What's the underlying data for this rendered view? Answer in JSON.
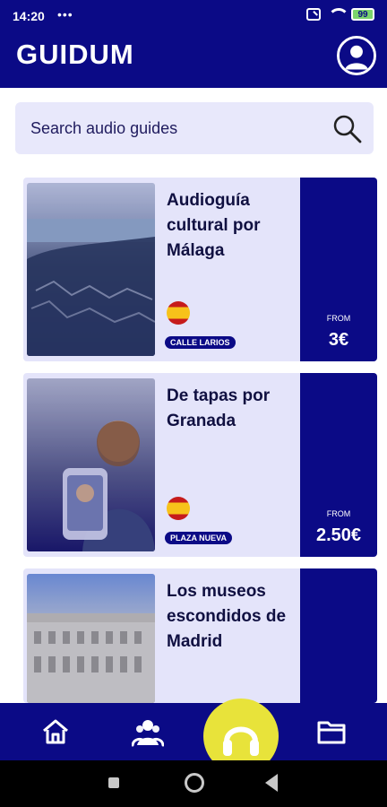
{
  "status": {
    "time": "14:20",
    "dots": "•••",
    "battery": "99"
  },
  "header": {
    "logo": "GUIDUM",
    "profile_icon": "profile-icon"
  },
  "search": {
    "placeholder": "Search audio guides",
    "icon": "search-icon"
  },
  "tours": [
    {
      "title": "Audioguía cultural por Málaga",
      "tag": "CALLE LARIOS",
      "from": "FROM",
      "price": "3€",
      "image": "malaga-aerial-image",
      "flag": "spain-flag-icon"
    },
    {
      "title": "De tapas por Granada",
      "tag": "PLAZA NUEVA",
      "from": "FROM",
      "price": "2.50€",
      "image": "granada-selfie-image",
      "flag": "spain-flag-icon"
    },
    {
      "title": "Los museos escondidos de Madrid",
      "image": "madrid-palace-image"
    }
  ],
  "bottom_nav": [
    {
      "name": "home-icon"
    },
    {
      "name": "community-icon"
    },
    {
      "name": "headphones-icon"
    },
    {
      "name": "folder-icon"
    }
  ],
  "colors": {
    "primary": "#0b0a86",
    "card": "#e4e4fa",
    "accent": "#e8e33a"
  }
}
